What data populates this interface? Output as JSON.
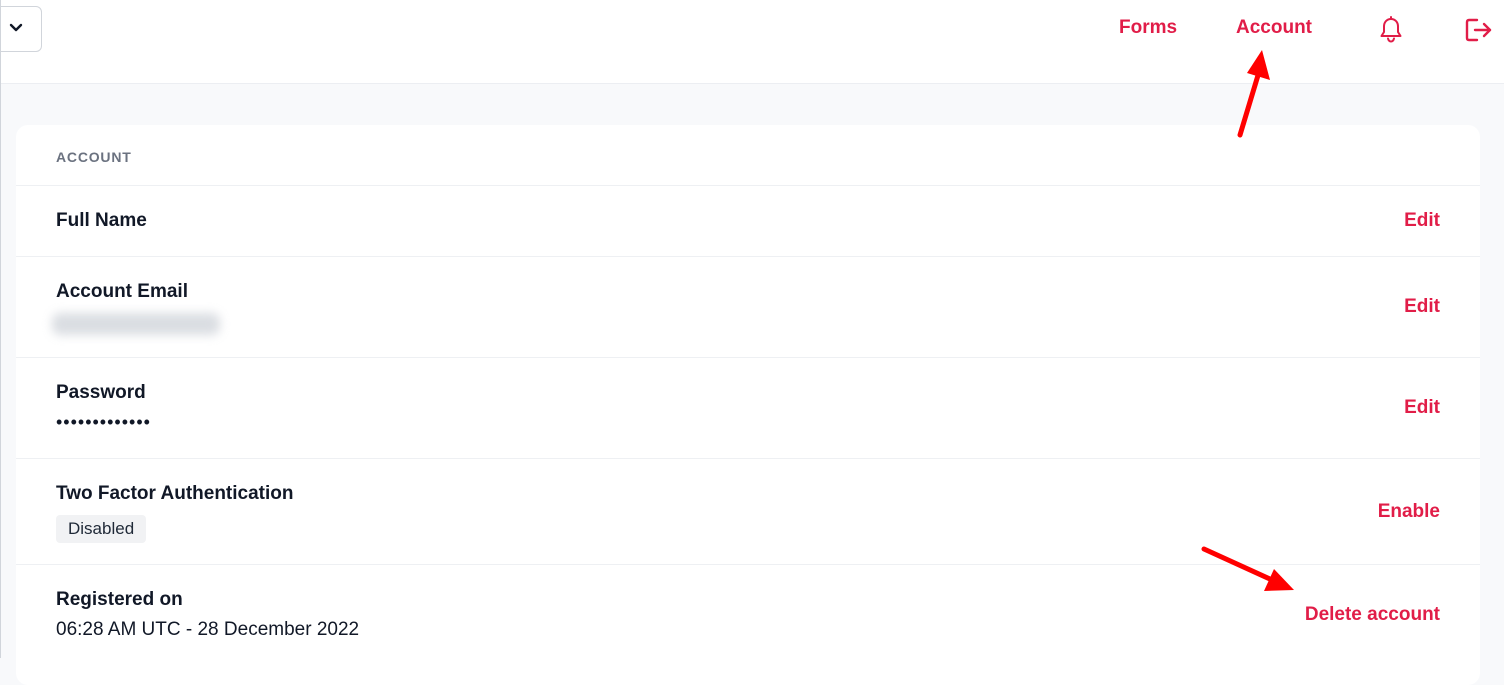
{
  "nav": {
    "forms": "Forms",
    "account": "Account"
  },
  "icons": {
    "dropdown": "chevron-down-icon",
    "notifications": "bell-icon",
    "logout": "logout-icon"
  },
  "colors": {
    "accent": "#e11d48",
    "annotation_arrow": "#ff0000"
  },
  "account_card": {
    "header": "ACCOUNT",
    "rows": [
      {
        "label": "Full Name",
        "value": "",
        "action": "Edit"
      },
      {
        "label": "Account Email",
        "value": "",
        "action": "Edit"
      },
      {
        "label": "Password",
        "value": "•••••••••••••",
        "action": "Edit"
      },
      {
        "label": "Two Factor Authentication",
        "badge": "Disabled",
        "action": "Enable"
      },
      {
        "label": "Registered on",
        "value": "06:28 AM UTC - 28 December 2022",
        "action": "Delete account"
      }
    ]
  }
}
